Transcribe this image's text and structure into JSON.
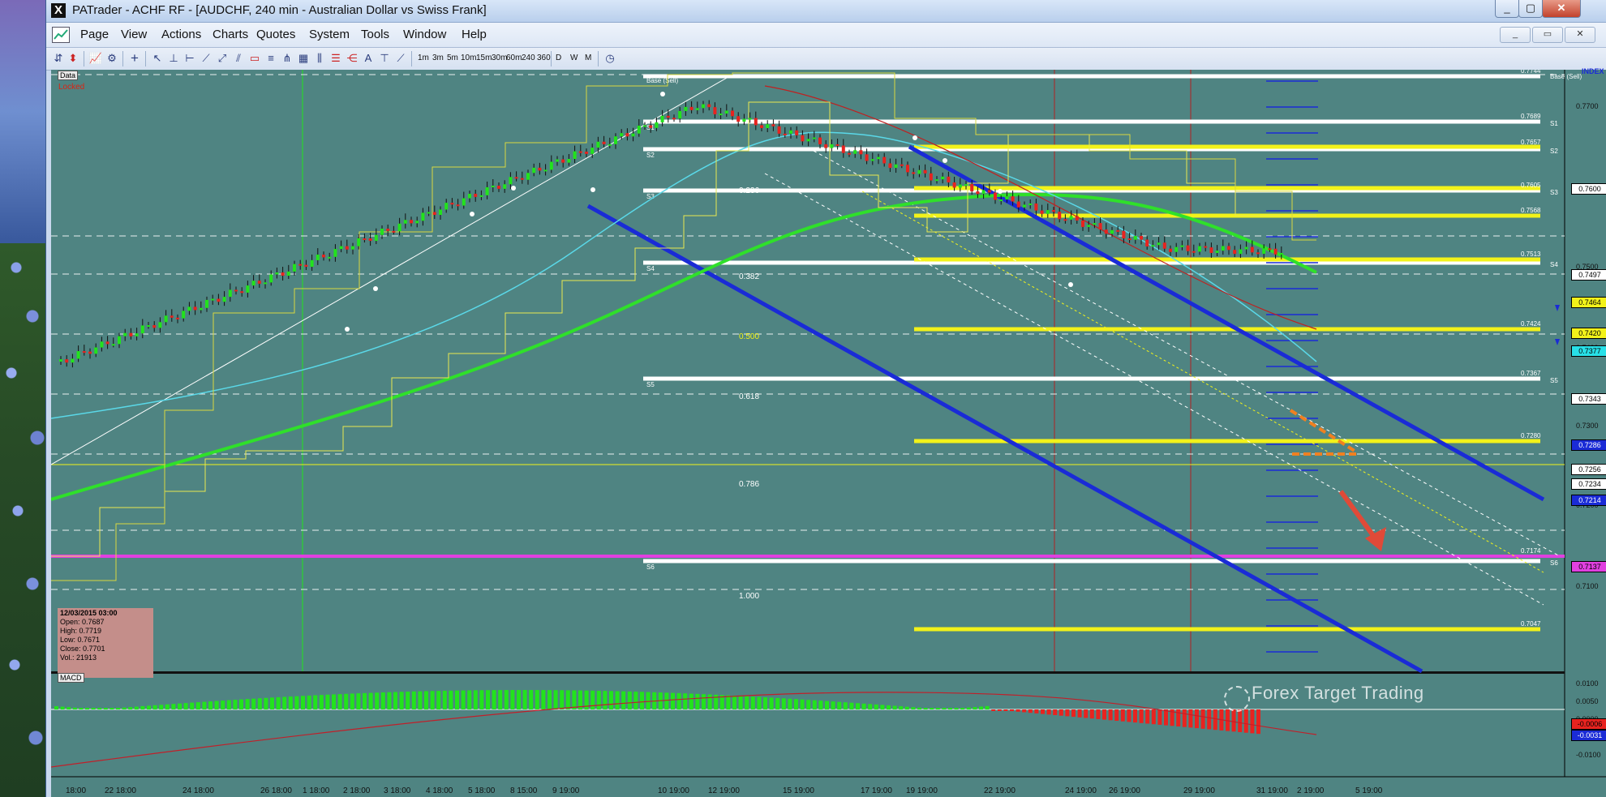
{
  "window": {
    "title": "PATrader - ACHF RF - [AUDCHF, 240 min - Australian Dollar vs Swiss Frank]",
    "controls": [
      "_",
      "▢",
      "✕"
    ]
  },
  "menubar": {
    "items": [
      "Page",
      "View",
      "Actions",
      "Charts",
      "Quotes",
      "System",
      "Tools",
      "Window",
      "Help"
    ],
    "mdi_controls": [
      "_",
      "▭",
      "✕"
    ]
  },
  "toolbar": {
    "timeframes": [
      "1m",
      "3m",
      "5m",
      "10m",
      "15m",
      "30m",
      "60m",
      "240",
      "360",
      "D",
      "W",
      "M"
    ]
  },
  "chart": {
    "data_tag": "Data",
    "locked_label": "Locked",
    "index_tag": "INDEX",
    "macd_tag": "MACD",
    "watermark": "Forex Target Trading",
    "colors": {
      "background": "#4f8482",
      "channel": "#1a2bd6",
      "support": "#ffffff",
      "resistance": "#f2f21a",
      "bull_candle": "#22e31c",
      "bear_candle": "#e8231f",
      "macd_line": "#c0202a",
      "ema": "#2fe02a"
    },
    "info_box": {
      "datetime": "12/03/2015 03:00",
      "open": "Open: 0.7687",
      "high": "High: 0.7719",
      "low": "Low: 0.7671",
      "close": "Close: 0.7701",
      "vol": "Vol.: 21913"
    },
    "fib_levels": [
      "0.236",
      "0.382",
      "0.500",
      "0.618",
      "0.786",
      "1.000"
    ],
    "pivot_labels_white": [
      "Base (Sell)",
      "S1",
      "S2",
      "S3",
      "S4",
      "S5",
      "S6"
    ],
    "pivot_values": [
      "0.7744",
      "0.7689",
      "0.7657",
      "0.7605",
      "0.7568",
      "0.7513",
      "0.7424",
      "0.7367",
      "0.7280",
      "0.7174",
      "0.7047"
    ],
    "price_axis": [
      "0.7700",
      "0.7600",
      "0.7500",
      "0.7400",
      "0.7300",
      "0.7200",
      "0.7100"
    ],
    "price_tags": [
      {
        "label": "0.7600",
        "bg": "#ffffff",
        "fg": "#000"
      },
      {
        "label": "0.7497",
        "bg": "#ffffff",
        "fg": "#000"
      },
      {
        "label": "0.7464",
        "bg": "#f2f21a",
        "fg": "#000"
      },
      {
        "label": "0.7420",
        "bg": "#f2f21a",
        "fg": "#000"
      },
      {
        "label": "0.7377",
        "bg": "#28e0e8",
        "fg": "#000"
      },
      {
        "label": "0.7343",
        "bg": "#ffffff",
        "fg": "#000"
      },
      {
        "label": "0.7286",
        "bg": "#1a2bd6",
        "fg": "#fff"
      },
      {
        "label": "0.7256",
        "bg": "#ffffff",
        "fg": "#000"
      },
      {
        "label": "0.7234",
        "bg": "#ffffff",
        "fg": "#000"
      },
      {
        "label": "0.7214",
        "bg": "#1a2bd6",
        "fg": "#fff"
      },
      {
        "label": "0.7137",
        "bg": "#e040e0",
        "fg": "#000"
      }
    ],
    "macd_axis": [
      "0.0100",
      "0.0050",
      "0.0000",
      "-0.0050",
      "-0.0100"
    ],
    "macd_tags": [
      {
        "label": "-0.0006",
        "bg": "#e8231f",
        "fg": "#000"
      },
      {
        "label": "-0.0031",
        "bg": "#1a2bd6",
        "fg": "#fff"
      }
    ],
    "dates": [
      "18:00",
      "22 18:00",
      "24 18:00",
      "26 18:00",
      "1 18:00",
      "2 18:00",
      "3 18:00",
      "4 18:00",
      "5 18:00",
      "8 15:00",
      "9 19:00",
      "10 19:00",
      "12 19:00",
      "15 19:00",
      "17 19:00",
      "19 19:00",
      "22 19:00",
      "24 19:00",
      "26 19:00",
      "29 19:00",
      "31 19:00",
      "2 19:00",
      "5 19:00"
    ]
  }
}
